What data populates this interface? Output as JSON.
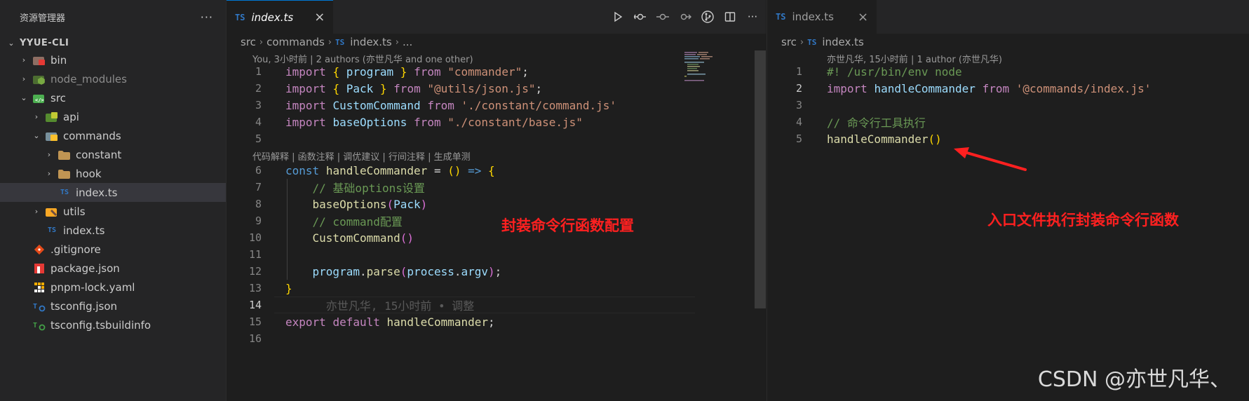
{
  "sidebar": {
    "title": "资源管理器",
    "more_icon": "ellipsis-icon",
    "items": [
      {
        "label": "YYUE-CLI",
        "depth": 0,
        "chevron": "down",
        "icon": "none"
      },
      {
        "label": "bin",
        "depth": 1,
        "chevron": "right",
        "icon": "bin-folder-icon"
      },
      {
        "label": "node_modules",
        "depth": 1,
        "chevron": "right",
        "icon": "node-folder-icon"
      },
      {
        "label": "src",
        "depth": 1,
        "chevron": "down",
        "icon": "src-folder-icon"
      },
      {
        "label": "api",
        "depth": 2,
        "chevron": "right",
        "icon": "api-folder-icon"
      },
      {
        "label": "commands",
        "depth": 2,
        "chevron": "down",
        "icon": "commands-folder-icon"
      },
      {
        "label": "constant",
        "depth": 3,
        "chevron": "right",
        "icon": "folder-icon"
      },
      {
        "label": "hook",
        "depth": 3,
        "chevron": "right",
        "icon": "folder-icon"
      },
      {
        "label": "index.ts",
        "depth": 3,
        "chevron": "none",
        "icon": "ts-icon"
      },
      {
        "label": "utils",
        "depth": 2,
        "chevron": "right",
        "icon": "utils-folder-icon"
      },
      {
        "label": "index.ts",
        "depth": 2,
        "chevron": "none",
        "icon": "ts-icon"
      },
      {
        "label": ".gitignore",
        "depth": 1,
        "chevron": "none",
        "icon": "git-icon"
      },
      {
        "label": "package.json",
        "depth": 1,
        "chevron": "none",
        "icon": "npm-icon"
      },
      {
        "label": "pnpm-lock.yaml",
        "depth": 1,
        "chevron": "none",
        "icon": "pnpm-icon"
      },
      {
        "label": "tsconfig.json",
        "depth": 1,
        "chevron": "none",
        "icon": "tsconfig-icon"
      },
      {
        "label": "tsconfig.tsbuildinfo",
        "depth": 1,
        "chevron": "none",
        "icon": "tsconfig-icon"
      }
    ],
    "selected_index": 8
  },
  "editor_left": {
    "tab": {
      "icon_text": "TS",
      "label": "index.ts",
      "close": "×"
    },
    "actions": [
      "run-icon",
      "git-compare-icon",
      "git-commit-icon",
      "git-next-icon",
      "git-branch-icon",
      "split-editor-icon",
      "more-actions-icon"
    ],
    "breadcrumb": [
      "src",
      "commands",
      "index.ts",
      "..."
    ],
    "blame_header": "You, 3小时前 | 2 authors (亦世凡华 and one other)",
    "codelens": "代码解释 | 函数注释 | 调优建议 | 行间注释 | 生成单测",
    "inline_blame": "亦世凡华, 15小时前 • 调整",
    "active_line": "14",
    "line_numbers": [
      "1",
      "2",
      "3",
      "4",
      "5",
      "6",
      "7",
      "8",
      "9",
      "10",
      "11",
      "12",
      "13",
      "14",
      "15",
      "16"
    ]
  },
  "editor_right": {
    "tab": {
      "icon_text": "TS",
      "label": "index.ts",
      "close": "×"
    },
    "breadcrumb": [
      "src",
      "index.ts"
    ],
    "blame_header": "亦世凡华, 15小时前 | 1 author (亦世凡华)",
    "active_line": "2",
    "line_numbers": [
      "1",
      "2",
      "3",
      "4",
      "5"
    ]
  },
  "annotations": {
    "left": "封装命令行函数配置",
    "right": "入口文件执行封装命令行函数",
    "arrow_color": "#ff2020"
  },
  "watermark": "CSDN @亦世凡华、",
  "colors": {
    "keyword": "#c586c0",
    "string": "#ce9178",
    "variable": "#9cdcfe",
    "function": "#dcdcaa",
    "comment": "#6a9955",
    "ts_blue": "#3178c6",
    "tab_accent": "#0078d4"
  }
}
